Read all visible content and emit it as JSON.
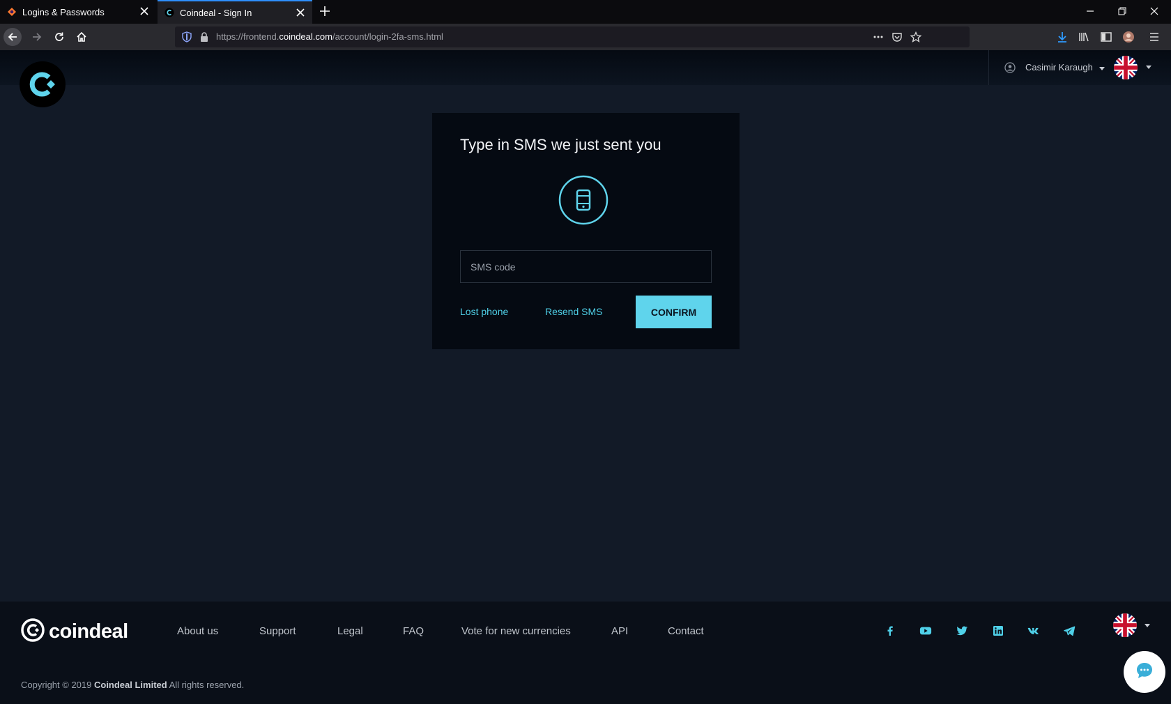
{
  "browser": {
    "tabs": [
      {
        "label": "Logins & Passwords"
      },
      {
        "label": "Coindeal - Sign In"
      }
    ],
    "url": {
      "prefix": "https://frontend.",
      "host": "coindeal.com",
      "path": "/account/login-2fa-sms.html"
    }
  },
  "header": {
    "user_name": "Casimir Karaugh"
  },
  "card": {
    "title": "Type in SMS we just sent you",
    "input_placeholder": "SMS code",
    "input_value": "",
    "lost_phone": "Lost phone",
    "resend_sms": "Resend SMS",
    "confirm": "CONFIRM"
  },
  "footer": {
    "brand": "coindeal",
    "links": [
      "About us",
      "Support",
      "Legal",
      "FAQ",
      "Vote for new currencies",
      "API",
      "Contact"
    ],
    "social_icons": [
      "facebook-icon",
      "youtube-icon",
      "twitter-icon",
      "linkedin-icon",
      "vk-icon",
      "telegram-icon"
    ],
    "copyright_prefix": "Copyright © 2019",
    "copyright_company": "Coindeal Limited",
    "copyright_suffix": "All rights reserved."
  },
  "colors": {
    "accent": "#5fd4ec",
    "page_bg": "#121a27",
    "card_bg": "#050a12"
  }
}
